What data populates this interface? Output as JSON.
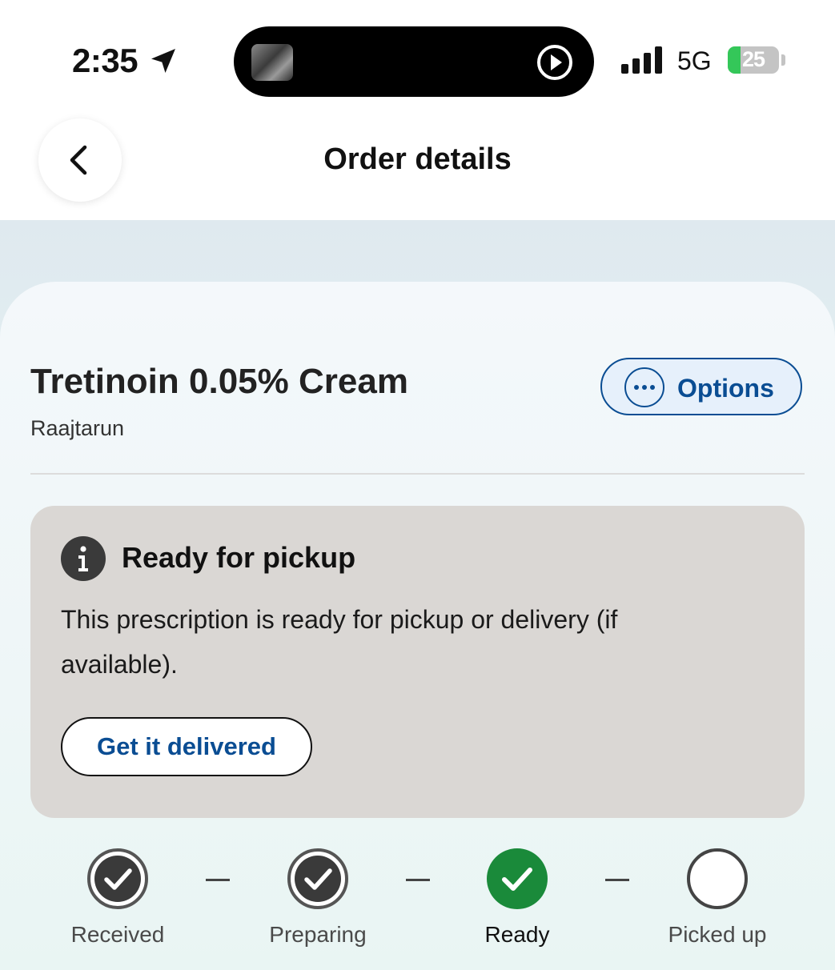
{
  "status_bar": {
    "time": "2:35",
    "network": "5G",
    "battery": "25",
    "battery_percent": 25
  },
  "header": {
    "title": "Order details"
  },
  "order": {
    "medication": "Tretinoin 0.05% Cream",
    "patient": "Raajtarun",
    "options_label": "Options"
  },
  "status_box": {
    "title": "Ready for pickup",
    "message": "This prescription is ready for pickup or delivery (if available).",
    "action_label": "Get it delivered"
  },
  "tracker": {
    "steps": [
      {
        "label": "Received",
        "state": "done"
      },
      {
        "label": "Preparing",
        "state": "done"
      },
      {
        "label": "Ready",
        "state": "current"
      },
      {
        "label": "Picked up",
        "state": "pending"
      }
    ]
  },
  "colors": {
    "accent_blue": "#0a4d93",
    "success_green": "#1a8a3a",
    "status_box_bg": "#dad7d4"
  },
  "icons": [
    "location-arrow-icon",
    "play-icon",
    "signal-icon",
    "battery-icon",
    "back-chevron-icon",
    "more-dots-icon",
    "info-icon",
    "check-icon",
    "empty-circle-icon"
  ]
}
